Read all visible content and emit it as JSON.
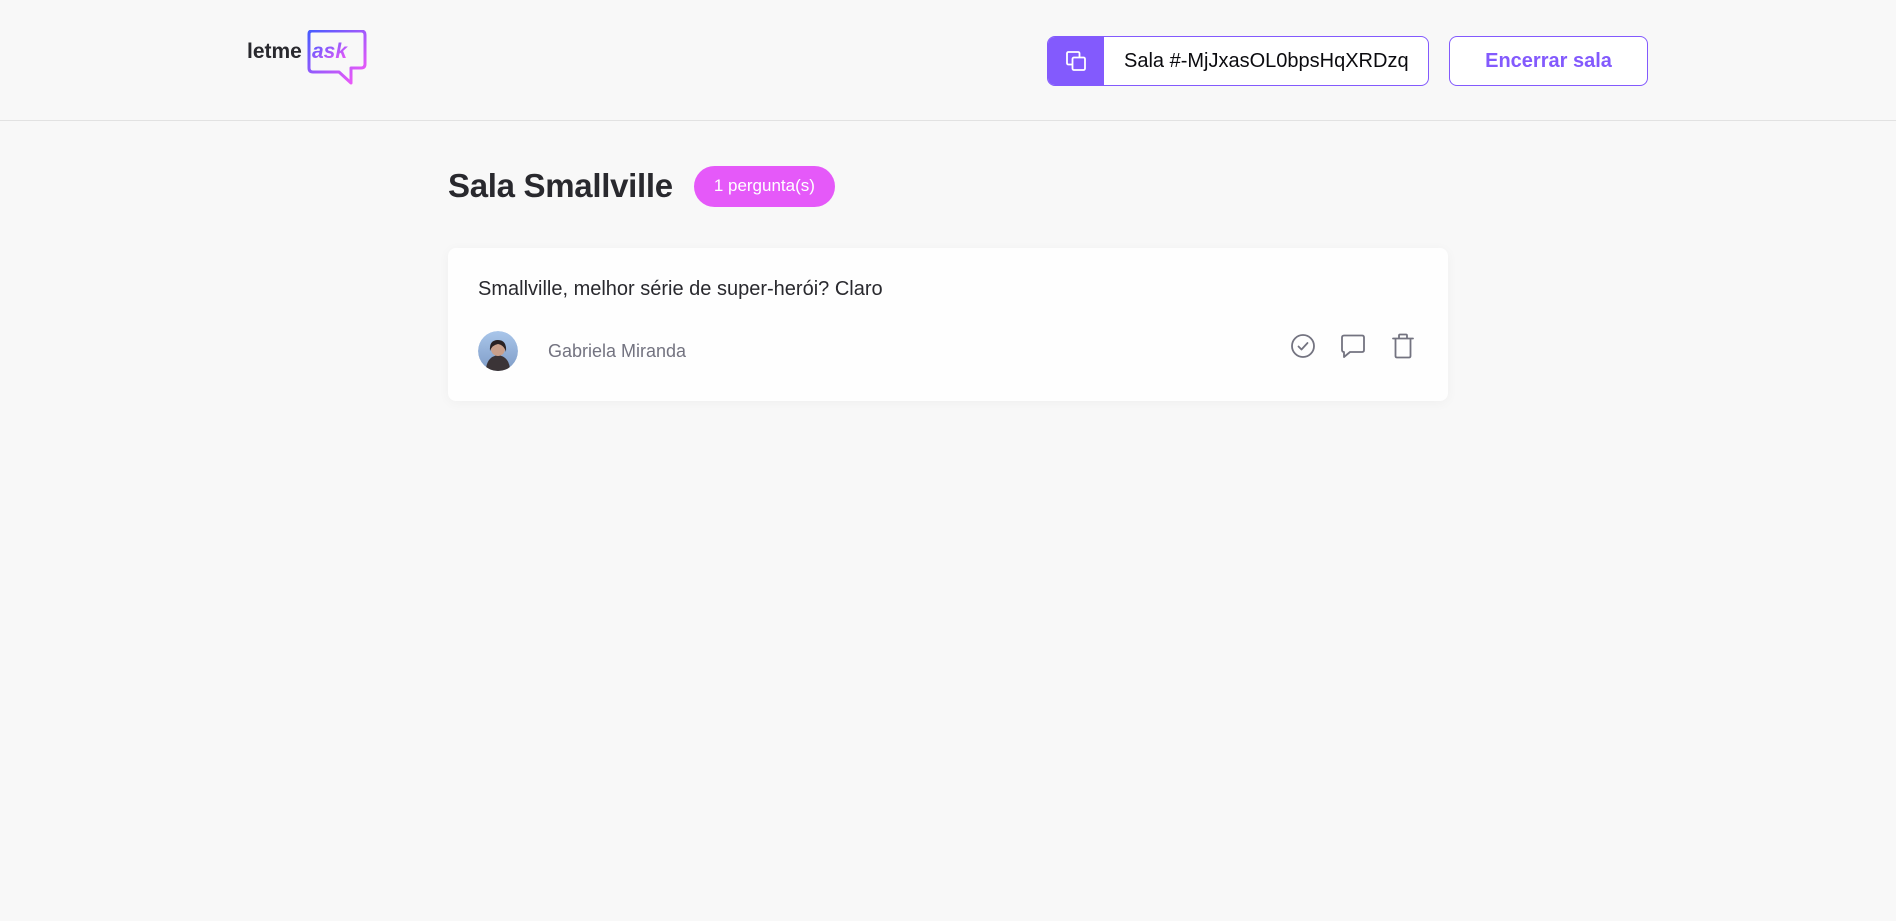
{
  "header": {
    "logo": {
      "part1": "letme",
      "part2": "ask",
      "dark_color": "#29292e",
      "gradient_start": "#485bff",
      "gradient_end": "#ff59f8"
    },
    "room_code": {
      "icon": "copy-icon",
      "label": "Sala #-MjJxasOL0bpsHqXRDzq"
    },
    "close_room_label": "Encerrar sala"
  },
  "room": {
    "title": "Sala Smallville",
    "question_count_label": "1 pergunta(s)"
  },
  "questions": [
    {
      "content": "Smallville, melhor série de super-herói? Claro",
      "author": {
        "name": "Gabriela Miranda"
      },
      "actions": [
        {
          "icon": "check-circle-icon"
        },
        {
          "icon": "message-bubble-icon"
        },
        {
          "icon": "trash-icon"
        }
      ]
    }
  ],
  "colors": {
    "accent": "#835afd",
    "badge": "#e559f9",
    "background": "#f8f8f8",
    "card": "#fefefe"
  }
}
